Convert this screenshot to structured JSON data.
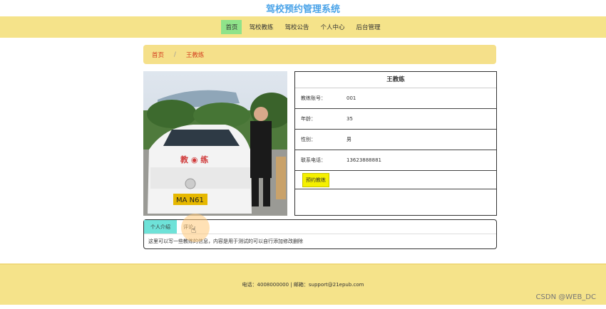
{
  "site": {
    "title": "驾校预约管理系统"
  },
  "nav": {
    "items": [
      {
        "label": "首页",
        "active": true
      },
      {
        "label": "驾校教练",
        "active": false
      },
      {
        "label": "驾校公告",
        "active": false
      },
      {
        "label": "个人中心",
        "active": false
      },
      {
        "label": "后台管理",
        "active": false
      }
    ]
  },
  "breadcrumb": {
    "home": "首页",
    "separator": "/",
    "current": "王教练"
  },
  "photo": {
    "icon": "coach-photo"
  },
  "coach": {
    "name": "王教练",
    "fields": [
      {
        "label": "教练账号：",
        "value": "001"
      },
      {
        "label": "年龄：",
        "value": "35"
      },
      {
        "label": "性别：",
        "value": "男"
      },
      {
        "label": "联系电话：",
        "value": "13623888881"
      }
    ],
    "book_label": "预约教练"
  },
  "tabs": {
    "items": [
      {
        "label": "个人介绍",
        "active": true
      },
      {
        "label": "评论",
        "active": false
      }
    ],
    "content": "这里可以写一些教练的信息，内容是用于测试的可以自行添加修改删除"
  },
  "footer": {
    "text": "电话：4008000000 | 邮箱：support@21epub.com"
  },
  "watermark": "CSDN @WEB_DC",
  "colors": {
    "accent": "#f5e38a",
    "title": "#4aa3e8",
    "active_nav": "#8fe38a",
    "active_tab": "#6ee2d8",
    "button": "#f5f000"
  }
}
